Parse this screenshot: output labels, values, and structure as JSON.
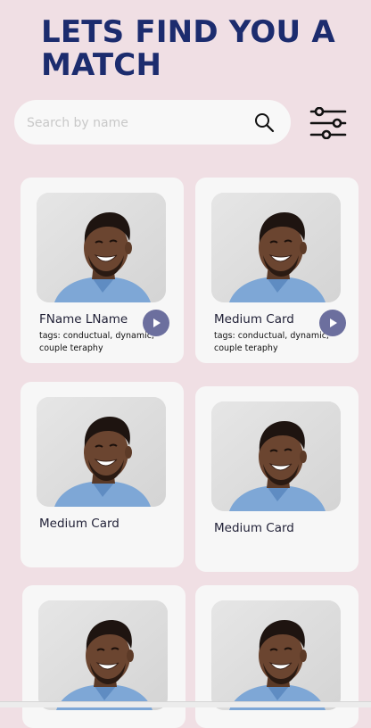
{
  "header": {
    "title": "LETS FIND YOU A MATCH"
  },
  "search": {
    "placeholder": "Search by name",
    "value": ""
  },
  "icons": {
    "search": "search-icon",
    "filter": "filter-sliders-icon",
    "play": "play-icon"
  },
  "colors": {
    "background": "#f0dfe4",
    "title": "#1c2c6e",
    "card": "#f7f7f7",
    "play_button": "#6c6f9e"
  },
  "cards": [
    {
      "name": "FName LName",
      "tags": "tags: conductual, dynamic, couple teraphy"
    },
    {
      "name": "Medium Card",
      "tags": "tags: conductual, dynamic, couple teraphy"
    },
    {
      "name": "Medium Card"
    },
    {
      "name": "Medium Card"
    },
    {},
    {}
  ]
}
